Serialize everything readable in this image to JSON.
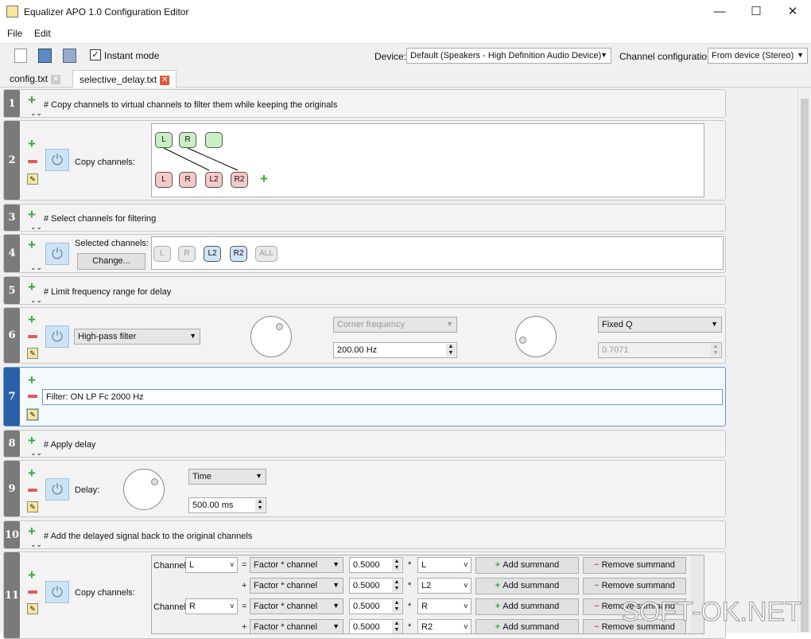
{
  "window": {
    "title": "Equalizer APO 1.0 Configuration Editor",
    "minimize": "—",
    "maximize": "☐",
    "close": "✕"
  },
  "menu": [
    "File",
    "Edit"
  ],
  "toolbar": {
    "instant_mode": "Instant mode",
    "instant_checked": true,
    "device_label": "Device:",
    "device_value": "Default (Speakers - High Definition Audio Device)",
    "channel_config_label": "Channel configuration:",
    "channel_config_value": "From device (Stereo)"
  },
  "tabs": [
    {
      "label": "config.txt",
      "active": false
    },
    {
      "label": "selective_delay.txt",
      "active": true
    }
  ],
  "rows": {
    "r1": {
      "num": "1",
      "text": "# Copy channels to virtual channels to filter them while keeping the originals"
    },
    "r2": {
      "num": "2",
      "label": "Copy channels:",
      "inputs": [
        "L",
        "R",
        ""
      ],
      "outputs": [
        "L",
        "R",
        "L2",
        "R2"
      ]
    },
    "r3": {
      "num": "3",
      "text": "# Select channels for filtering"
    },
    "r4": {
      "num": "4",
      "label": "Selected channels:",
      "change": "Change...",
      "channels": [
        "L",
        "R",
        "L2",
        "R2",
        "ALL"
      ]
    },
    "r5": {
      "num": "5",
      "text": "# Limit frequency range for delay"
    },
    "r6": {
      "num": "6",
      "filter_type": "High-pass filter",
      "freq_mode": "Corner frequency",
      "freq": "200.00 Hz",
      "q_mode": "Fixed Q",
      "q": "0.7071"
    },
    "r7": {
      "num": "7",
      "text": "Filter: ON LP Fc 2000 Hz"
    },
    "r8": {
      "num": "8",
      "text": "# Apply delay"
    },
    "r9": {
      "num": "9",
      "label": "Delay:",
      "unit": "Time",
      "value": "500.00 ms"
    },
    "r10": {
      "num": "10",
      "text": "# Add the delayed signal back to the original channels"
    },
    "r11": {
      "num": "11",
      "label": "Copy channels:",
      "channel_label": "Channel",
      "add": "Add summand",
      "remove": "Remove summand",
      "lines": [
        {
          "ch": "L",
          "op": "=",
          "mode": "Factor * channel",
          "factor": "0.5000",
          "src": "L"
        },
        {
          "ch": "",
          "op": "+",
          "mode": "Factor * channel",
          "factor": "0.5000",
          "src": "L2"
        },
        {
          "ch": "R",
          "op": "=",
          "mode": "Factor * channel",
          "factor": "0.5000",
          "src": "R"
        },
        {
          "ch": "",
          "op": "+",
          "mode": "Factor * channel",
          "factor": "0.5000",
          "src": "R2"
        }
      ]
    }
  },
  "watermark": "SOFT-OK.NET"
}
